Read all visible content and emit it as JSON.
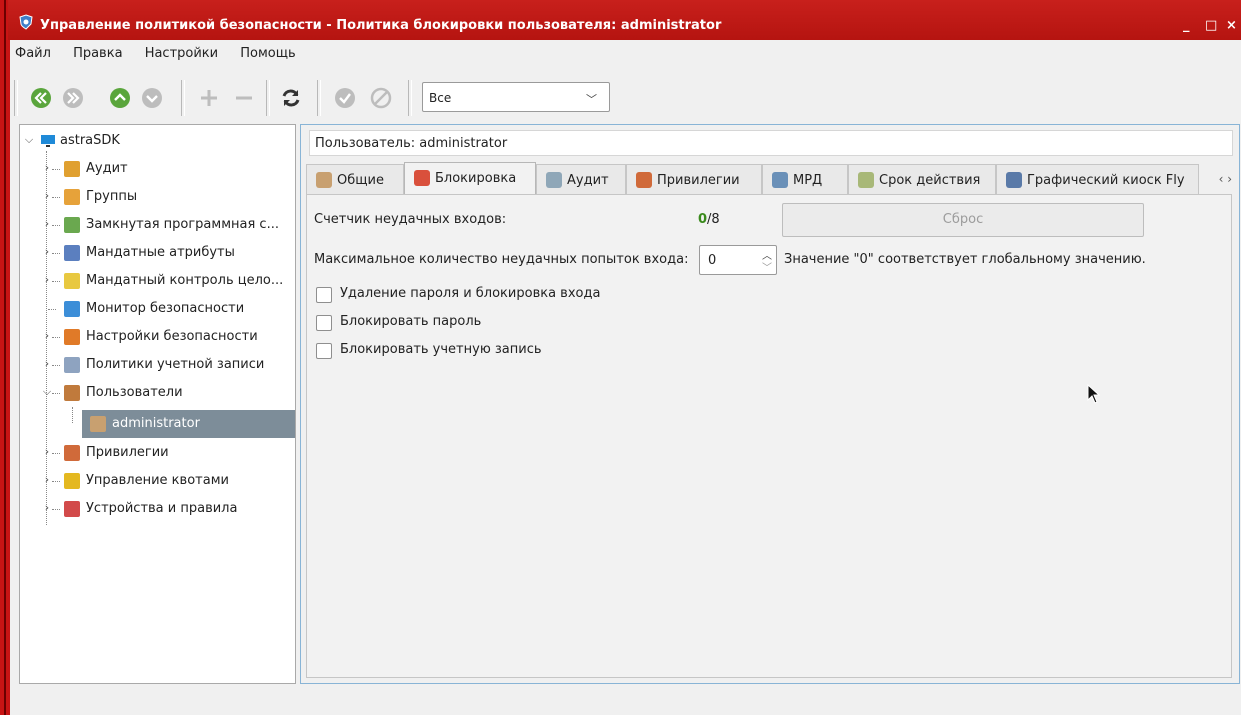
{
  "window": {
    "title": "Управление политикой безопасности - Политика блокировки пользователя: administrator",
    "minimize": "_",
    "maximize": "□",
    "close": "×"
  },
  "menu": [
    "Файл",
    "Правка",
    "Настройки",
    "Помощь"
  ],
  "toolbar": {
    "filter_value": "Все"
  },
  "tree": {
    "root": "astraSDK",
    "items": [
      {
        "label": "Аудит",
        "icon": "audit-icon",
        "color": "#e0a030"
      },
      {
        "label": "Группы",
        "icon": "groups-icon",
        "color": "#e6a23a"
      },
      {
        "label": "Замкнутая программная с...",
        "icon": "closed-env-icon",
        "color": "#6aa84f"
      },
      {
        "label": "Мандатные атрибуты",
        "icon": "mandatory-attributes-icon",
        "color": "#5b7fbf"
      },
      {
        "label": "Мандатный контроль цело...",
        "icon": "integrity-control-icon",
        "color": "#e8c840"
      },
      {
        "label": "Монитор безопасности",
        "icon": "security-monitor-icon",
        "color": "#3c8ed8"
      },
      {
        "label": "Настройки безопасности",
        "icon": "security-settings-icon",
        "color": "#e07a28"
      },
      {
        "label": "Политики учетной записи",
        "icon": "account-policy-icon",
        "color": "#8ea3c0"
      },
      {
        "label": "Пользователи",
        "icon": "users-icon",
        "color": "#c07a3c"
      },
      {
        "label": "administrator",
        "icon": "user-icon",
        "color": "#c8a070"
      },
      {
        "label": "Привилегии",
        "icon": "privileges-icon",
        "color": "#d06a3a"
      },
      {
        "label": "Управление квотами",
        "icon": "quota-icon",
        "color": "#e4b820"
      },
      {
        "label": "Устройства и правила",
        "icon": "devices-icon",
        "color": "#d24a4a"
      }
    ]
  },
  "panel": {
    "user_header": "Пользователь: administrator",
    "tabs": [
      {
        "label": "Общие",
        "icon": "general-tab-icon"
      },
      {
        "label": "Блокировка",
        "icon": "lock-tab-icon"
      },
      {
        "label": "Аудит",
        "icon": "audit-tab-icon"
      },
      {
        "label": "Привилегии",
        "icon": "privileges-tab-icon"
      },
      {
        "label": "МРД",
        "icon": "mrd-tab-icon"
      },
      {
        "label": "Срок действия",
        "icon": "expiry-tab-icon"
      },
      {
        "label": "Графический киоск Fly",
        "icon": "kiosk-tab-icon"
      }
    ],
    "tab_scroll": "‹ ›",
    "failed_counter_label": "Счетчик неудачных входов:",
    "failed_count": "0",
    "failed_max": "/8",
    "reset_label": "Сброс",
    "max_attempts_label": "Максимальное количество неудачных попыток входа:",
    "max_attempts_value": "0",
    "max_attempts_hint": "Значение \"0\" соответствует глобальному значению.",
    "checkboxes": [
      {
        "label": "Удаление пароля и блокировка входа",
        "checked": false
      },
      {
        "label": "Блокировать пароль",
        "checked": false
      },
      {
        "label": "Блокировать учетную запись",
        "checked": false
      }
    ]
  },
  "colors": {
    "titlebar": "#c01a16",
    "selection": "#7d8d99",
    "green_counter": "#3a8a1c",
    "panel_border": "#88b4d6"
  }
}
